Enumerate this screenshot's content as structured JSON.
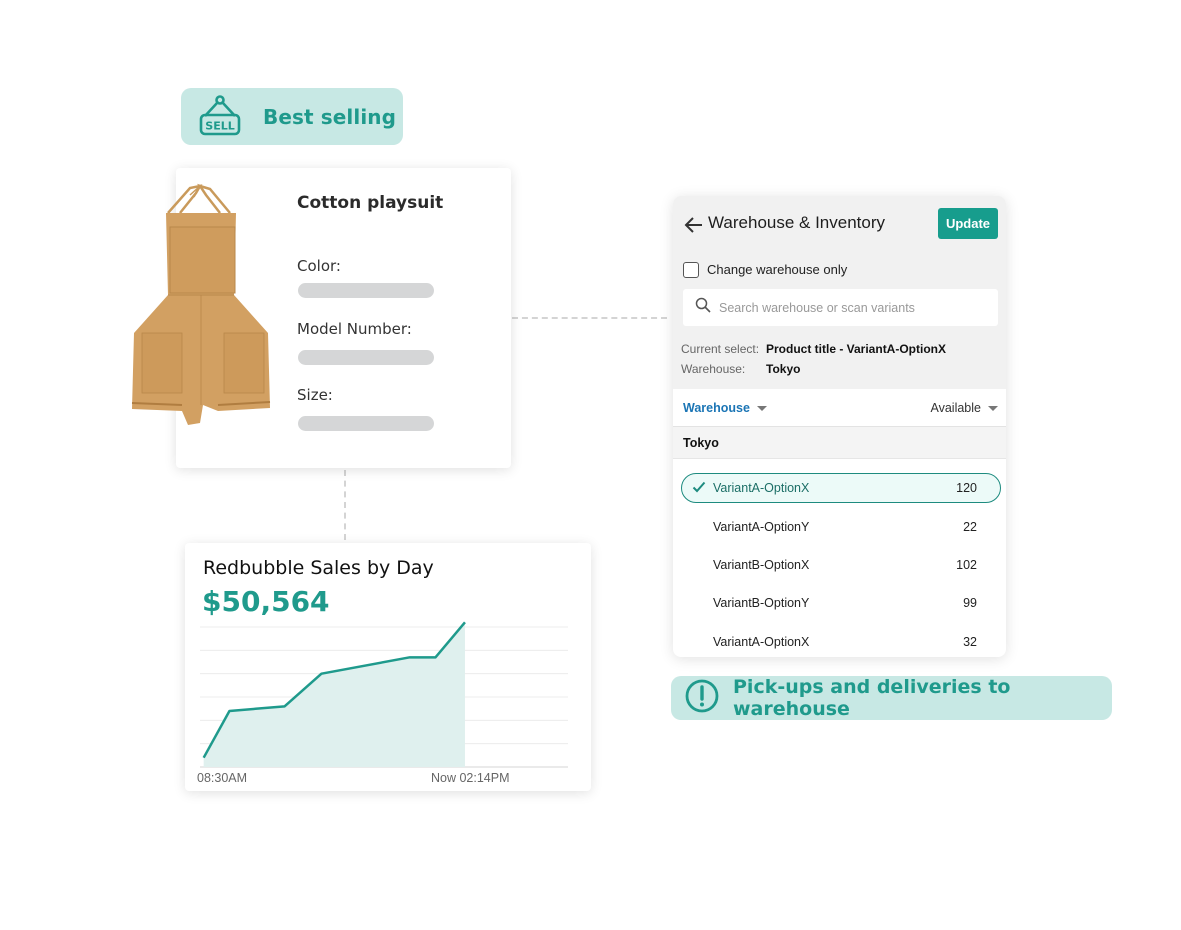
{
  "badges": {
    "best_selling": {
      "label": "Best selling",
      "icon": "sell-sign-icon"
    },
    "pickup": {
      "label": "Pick-ups and deliveries to warehouse",
      "icon": "exclamation-circle-icon"
    }
  },
  "colors": {
    "accent": "#1f9a8c",
    "badge_bg": "#c7e8e4",
    "button": "#179d8d",
    "link_blue": "#1b75b5",
    "placeholder_bar": "#d5d6d7"
  },
  "product": {
    "title": "Cotton playsuit",
    "image": "playsuit-image",
    "fields": [
      {
        "label": "Color:"
      },
      {
        "label": "Model Number:"
      },
      {
        "label": "Size:"
      }
    ]
  },
  "warehouse_panel": {
    "title": "Warehouse & Inventory",
    "back_icon": "arrow-left-icon",
    "update_label": "Update",
    "checkbox": {
      "label": "Change warehouse only",
      "checked": false
    },
    "search": {
      "placeholder": "Search warehouse or scan variants",
      "value": ""
    },
    "current_select": {
      "label": "Current select:",
      "value": "Product title - VariantA-OptionX"
    },
    "warehouse": {
      "label": "Warehouse:",
      "value": "Tokyo"
    },
    "columns": {
      "warehouse": "Warehouse",
      "available": "Available"
    },
    "group": "Tokyo",
    "rows": [
      {
        "name": "VariantA-OptionX",
        "qty": "120",
        "selected": true
      },
      {
        "name": "VariantA-OptionY",
        "qty": "22",
        "selected": false
      },
      {
        "name": "VariantB-OptionX",
        "qty": "102",
        "selected": false
      },
      {
        "name": "VariantB-OptionY",
        "qty": "99",
        "selected": false
      },
      {
        "name": "VariantA-OptionX",
        "qty": "32",
        "selected": false
      }
    ]
  },
  "sales": {
    "title": "Redbubble Sales by Day",
    "total": "$50,564"
  },
  "chart_data": {
    "type": "area",
    "title": "Redbubble Sales by Day",
    "subtitle": "$50,564",
    "x_labels": [
      "08:30AM",
      "Now 02:14PM"
    ],
    "x": [
      0.01,
      0.08,
      0.23,
      0.33,
      0.57,
      0.64,
      0.72
    ],
    "values": [
      0.4,
      2.4,
      2.6,
      4.0,
      4.7,
      4.7,
      6.2
    ],
    "xlim": [
      0,
      1
    ],
    "ylim": [
      0,
      6
    ],
    "gridlines": 6,
    "grid": true,
    "xlabel": "",
    "ylabel": ""
  }
}
